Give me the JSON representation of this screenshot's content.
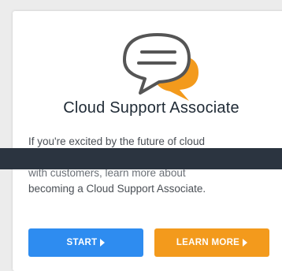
{
  "card": {
    "title": "Cloud Support Associate",
    "description_line1": "If you're excited by the future of cloud",
    "description_line2": "with customers, learn more about",
    "description_line3": "becoming a Cloud Support Associate.",
    "icon": "chat-bubbles-icon"
  },
  "buttons": {
    "start_label": "START",
    "learn_more_label": "LEARN MORE"
  },
  "colors": {
    "start": "#2e8cf0",
    "learn_more": "#f39a1c",
    "banner": "#2b3440",
    "bubble_outline": "#555555",
    "bubble_accent": "#f39a1c"
  }
}
